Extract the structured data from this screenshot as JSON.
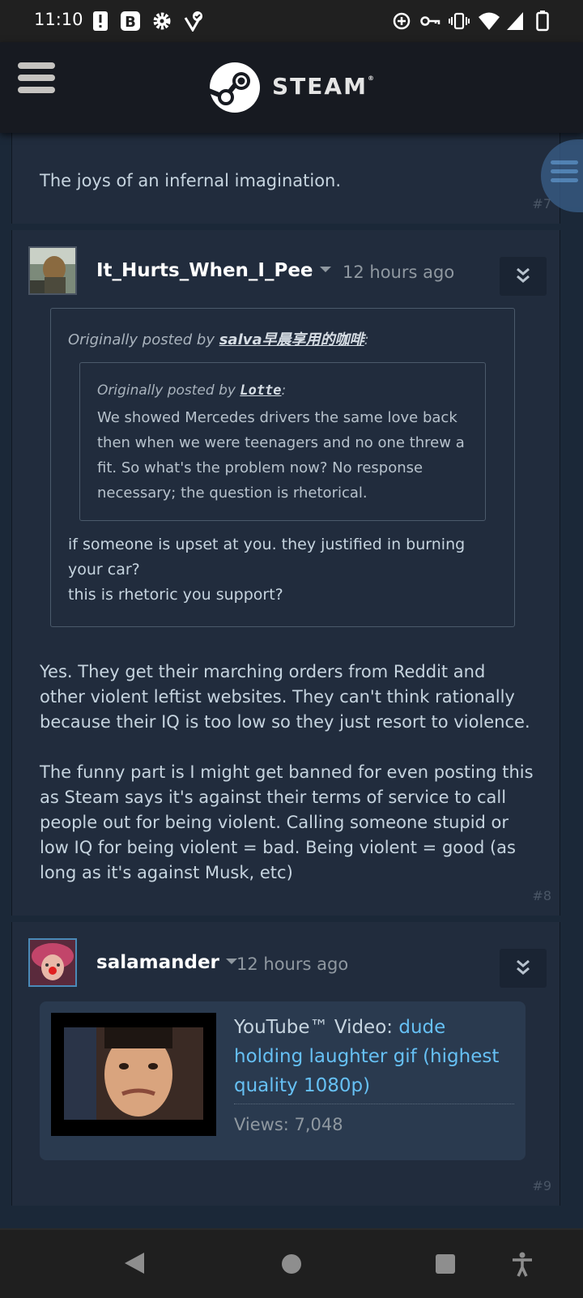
{
  "status_bar": {
    "time": "11:10"
  },
  "header": {
    "brand": "STEAM",
    "brand_mark": "®"
  },
  "posts": [
    {
      "text": "The joys of an infernal imagination.",
      "number": "#7"
    },
    {
      "author": "It_Hurts_When_I_Pee",
      "time": "12 hours ago",
      "quote": {
        "prefix": "Originally posted by",
        "author": "salva早晨享用的咖啡",
        "nested": {
          "prefix": "Originally posted by",
          "author": "Lotte",
          "text": "We showed Mercedes drivers the same love back then when we were teenagers and no one threw a fit. So what's the problem now? No response necessary; the question is rhetorical."
        },
        "text_line1": "if someone is upset at you. they justified in burning your car?",
        "text_line2": "this is rhetoric you support?"
      },
      "paragraph1": "Yes. They get their marching orders from Reddit and other violent leftist websites. They can't think rationally because their IQ is too low so they just resort to violence.",
      "paragraph2": "The funny part is I might get banned for even posting this as Steam says it's against their terms of service to call people out for being violent. Calling someone stupid or low IQ for being violent = bad. Being violent = good (as long as it's against Musk, etc)",
      "number": "#8"
    },
    {
      "author": "salamander",
      "time": "12 hours ago",
      "embed": {
        "source": "YouTube™ Video:",
        "title": "dude holding laughter gif (highest quality 1080p)",
        "views": "Views: 7,048"
      },
      "number": "#9"
    }
  ],
  "icons": [
    "menu-icon",
    "steam-logo-icon",
    "post-menu-chevron-icon",
    "back-icon",
    "home-icon",
    "recents-icon",
    "accessibility-icon"
  ]
}
